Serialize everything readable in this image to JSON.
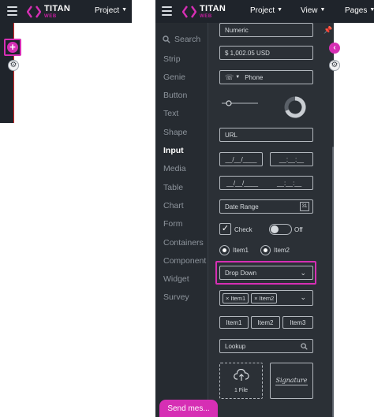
{
  "app": {
    "logo_title": "TITAN",
    "logo_sub": "WEB",
    "brand_color": "#d62fb4"
  },
  "left_panel": {
    "menu": {
      "project": "Project"
    }
  },
  "right_panel": {
    "menu": {
      "project": "Project",
      "view": "View",
      "pages": "Pages"
    }
  },
  "sidebar": {
    "search_placeholder": "Search",
    "items": [
      {
        "label": "Strip"
      },
      {
        "label": "Genie"
      },
      {
        "label": "Button"
      },
      {
        "label": "Text"
      },
      {
        "label": "Shape"
      },
      {
        "label": "Input",
        "active": true
      },
      {
        "label": "Media"
      },
      {
        "label": "Table"
      },
      {
        "label": "Chart"
      },
      {
        "label": "Form"
      },
      {
        "label": "Containers"
      },
      {
        "label": "Component"
      },
      {
        "label": "Widget"
      },
      {
        "label": "Survey"
      }
    ]
  },
  "inputs": {
    "numeric": "Numeric",
    "currency": "$ 1,002.05 USD",
    "phone": "Phone",
    "url": "URL",
    "date": "__/__/____",
    "time": "__:__:__",
    "date2": "__/__/____",
    "time2": "__:__:__",
    "date_range": "Date Range",
    "check_label": "Check",
    "toggle_label": "Off",
    "radio1": "Item1",
    "radio2": "Item2",
    "dropdown": "Drop Down",
    "multi_chips": [
      "Item1",
      "Item2"
    ],
    "segment": [
      "Item1",
      "Item2",
      "Item3"
    ],
    "lookup": "Lookup",
    "file_label": "1 File",
    "signature": "Signature"
  },
  "send_message": "Send mes..."
}
